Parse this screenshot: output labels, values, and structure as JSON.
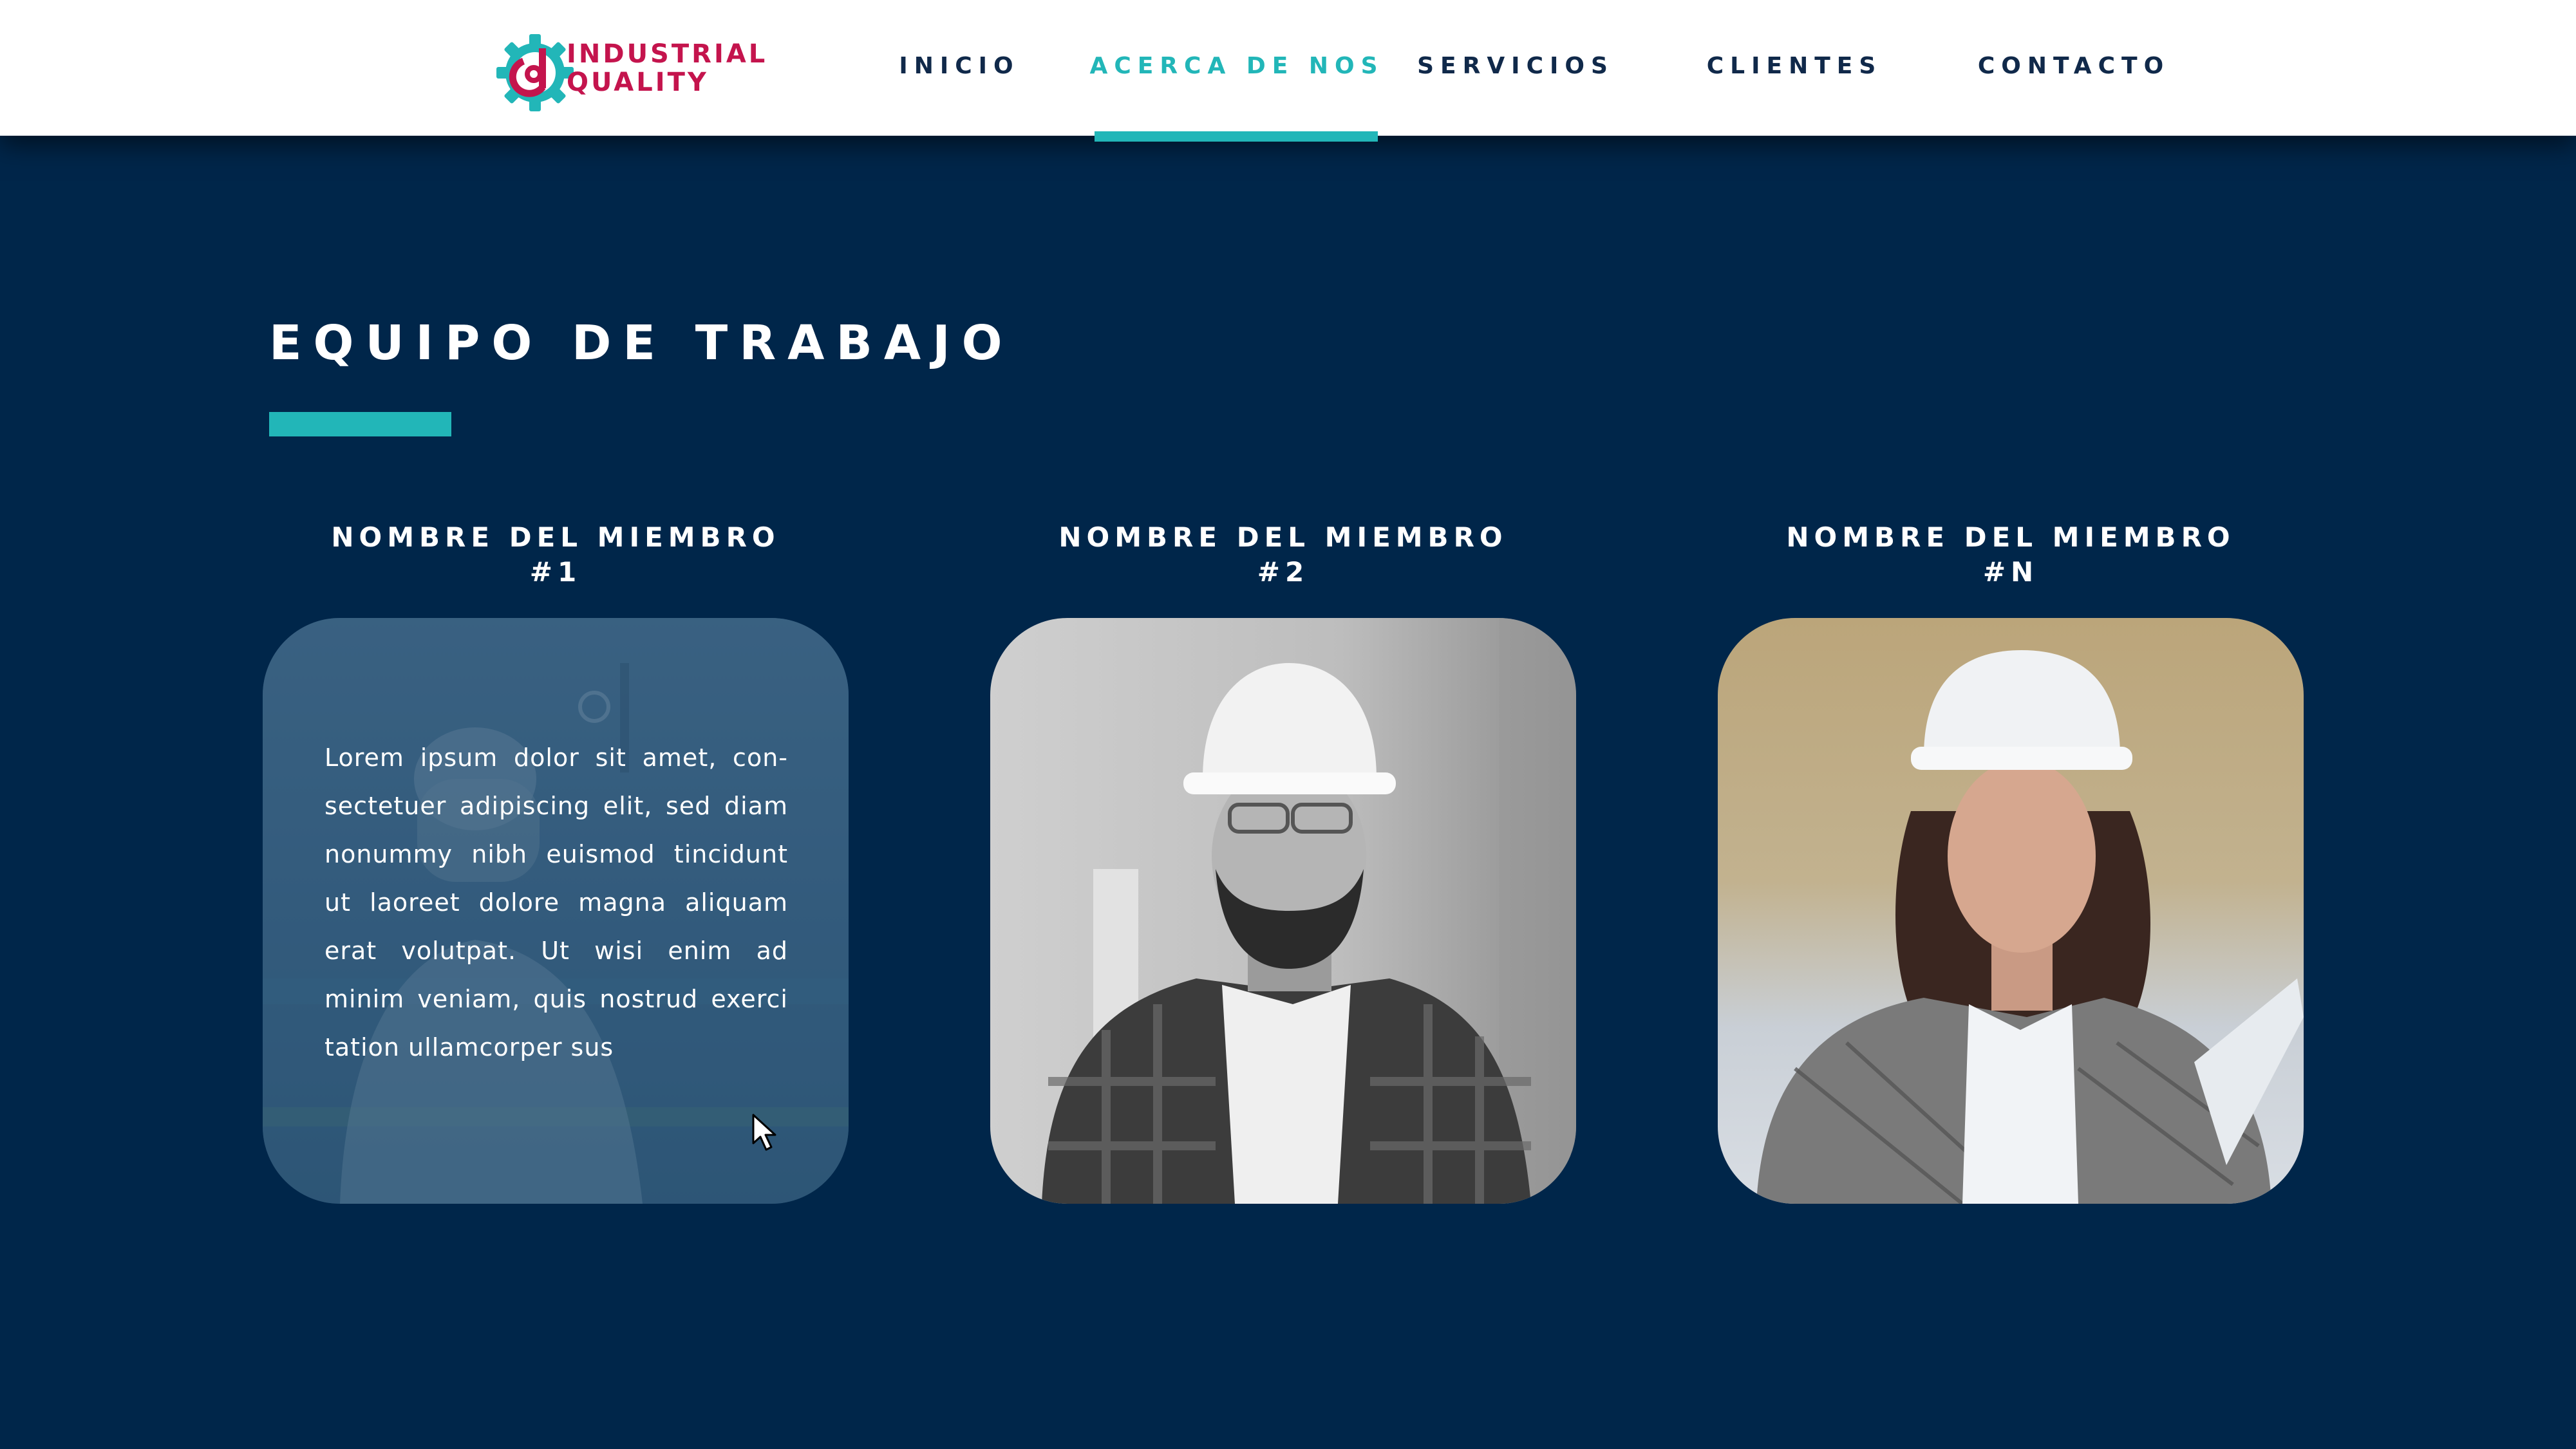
{
  "brand": {
    "line1": "INDUSTRIAL",
    "line2": "QUALITY",
    "colors": {
      "primary": "#c4144d",
      "accent": "#22b6b8"
    }
  },
  "nav": {
    "items": [
      {
        "label": "INICIO",
        "active": false
      },
      {
        "label": "ACERCA DE NOS",
        "active": true
      },
      {
        "label": "SERVICIOS",
        "active": false
      },
      {
        "label": "CLIENTES",
        "active": false
      },
      {
        "label": "CONTACTO",
        "active": false
      }
    ]
  },
  "section": {
    "title": "EQUIPO DE TRABAJO"
  },
  "members": [
    {
      "name_line1": "NOMBRE DEL MIEMBRO",
      "name_line2": "#1",
      "bio": "Lorem ipsum dolor sit amet, con-sectetuer adipiscing elit, sed diam nonummy nibh euismod tincidunt ut laoreet dolore magna aliquam erat volutpat. Ut wisi enim ad minim veniam, quis nostrud exerci tation ullamcorper sus"
    },
    {
      "name_line1": "NOMBRE DEL MIEMBRO",
      "name_line2": "#2"
    },
    {
      "name_line1": "NOMBRE DEL MIEMBRO",
      "name_line2": "#N"
    }
  ],
  "colors": {
    "background": "#00264a",
    "header_bg": "#ffffff",
    "nav_text": "#10294a",
    "accent": "#22b6b8"
  }
}
